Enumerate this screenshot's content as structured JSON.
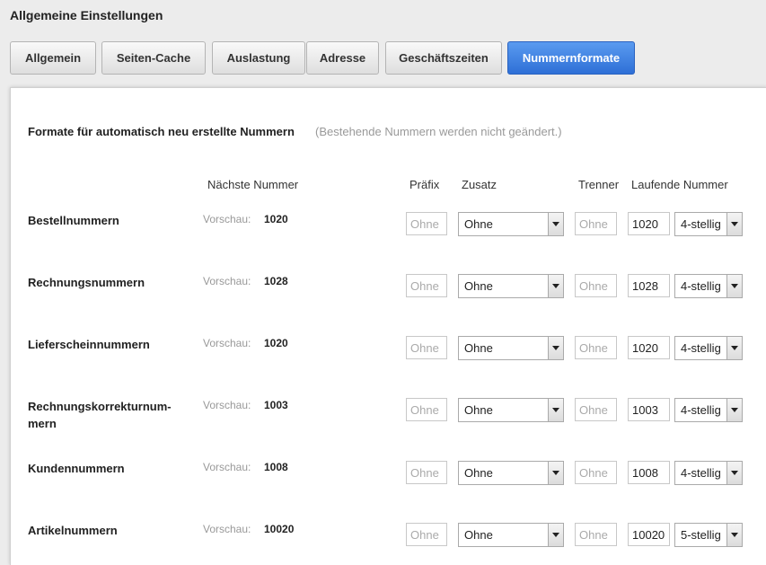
{
  "page_title": "Allgemeine Einstellungen",
  "tabs": [
    {
      "label": "Allgemein",
      "active": false
    },
    {
      "label": "Seiten-Cache",
      "active": false
    },
    {
      "label": "Auslastung",
      "active": false
    },
    {
      "label": "Adresse",
      "active": false
    },
    {
      "label": "Geschäftszeiten",
      "active": false
    },
    {
      "label": "Nummernformate",
      "active": true
    }
  ],
  "section": {
    "heading": "Formate für automatisch neu erstellte Nummern",
    "note": "(Bestehende Nummern werden nicht geändert.)"
  },
  "columns": {
    "next": "Nächste Nummer",
    "prefix": "Präfix",
    "suffix": "Zusatz",
    "separator": "Trenner",
    "running": "Laufende Nummer"
  },
  "preview_label": "Vorschau:",
  "rows": [
    {
      "label": "Bestellnummern",
      "preview": "1020",
      "prefix_placeholder": "Ohne",
      "zusatz": "Ohne",
      "separator_placeholder": "Ohne",
      "running": "1020",
      "digits": "4-stellig"
    },
    {
      "label": "Rechnungsnummern",
      "preview": "1028",
      "prefix_placeholder": "Ohne",
      "zusatz": "Ohne",
      "separator_placeholder": "Ohne",
      "running": "1028",
      "digits": "4-stellig"
    },
    {
      "label": "Lieferscheinnummern",
      "preview": "1020",
      "prefix_placeholder": "Ohne",
      "zusatz": "Ohne",
      "separator_placeholder": "Ohne",
      "running": "1020",
      "digits": "4-stellig"
    },
    {
      "label": "Rechnungskorrekturnum-mern",
      "label_line1": "Rechnungskorrekturnum-",
      "label_line2": "mern",
      "preview": "1003",
      "prefix_placeholder": "Ohne",
      "zusatz": "Ohne",
      "separator_placeholder": "Ohne",
      "running": "1003",
      "digits": "4-stellig"
    },
    {
      "label": "Kundennummern",
      "preview": "1008",
      "prefix_placeholder": "Ohne",
      "zusatz": "Ohne",
      "separator_placeholder": "Ohne",
      "running": "1008",
      "digits": "4-stellig"
    },
    {
      "label": "Artikelnummern",
      "preview": "10020",
      "prefix_placeholder": "Ohne",
      "zusatz": "Ohne",
      "separator_placeholder": "Ohne",
      "running": "10020",
      "digits": "5-stellig"
    }
  ],
  "colors": {
    "active_tab": "#3a7be0",
    "placeholder_text": "#aaaaaa"
  }
}
